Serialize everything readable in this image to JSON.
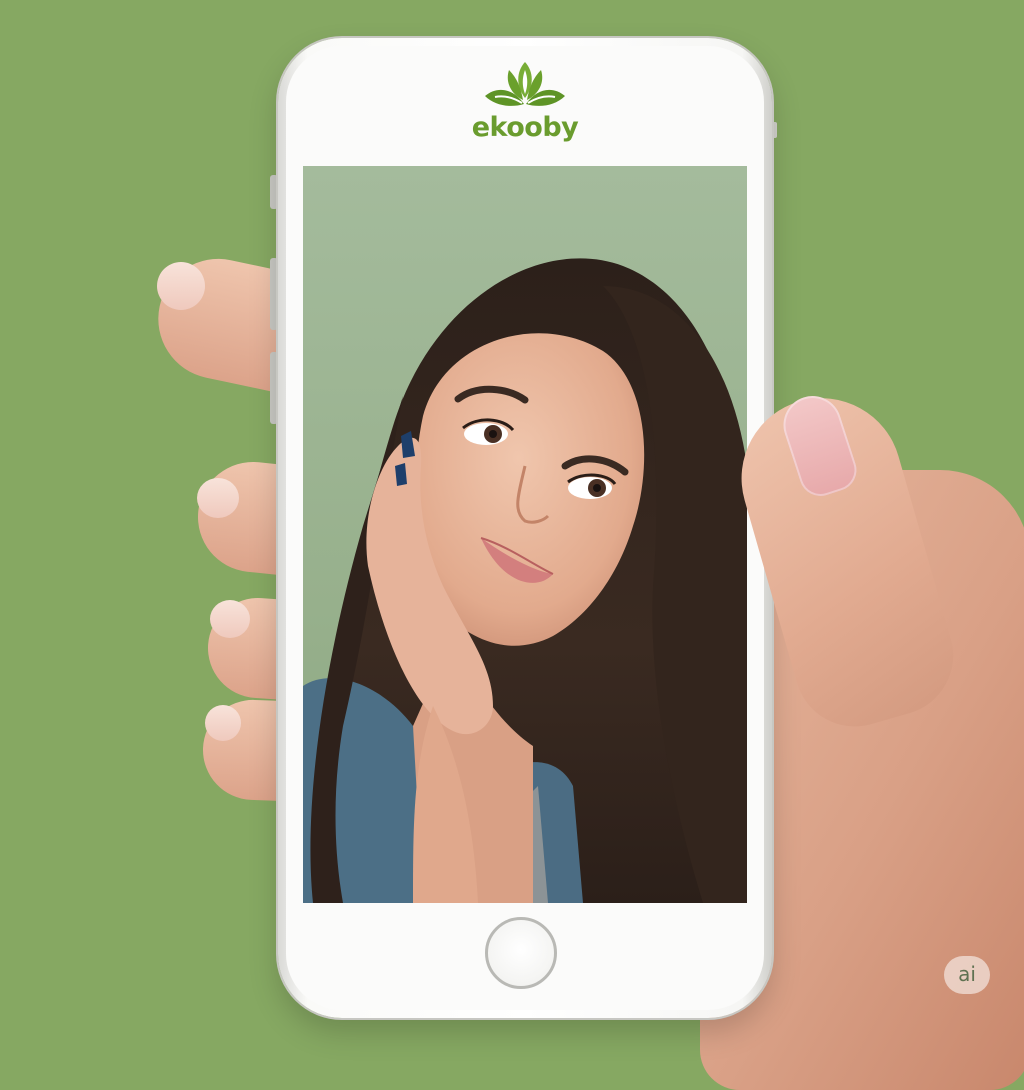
{
  "app": {
    "brand_name": "ekooby",
    "logo_icon": "lotus-leaf-icon",
    "brand_color": "#6a9c2e"
  },
  "scene": {
    "background_color": "#86a862"
  },
  "watermark": {
    "label": "ai"
  }
}
